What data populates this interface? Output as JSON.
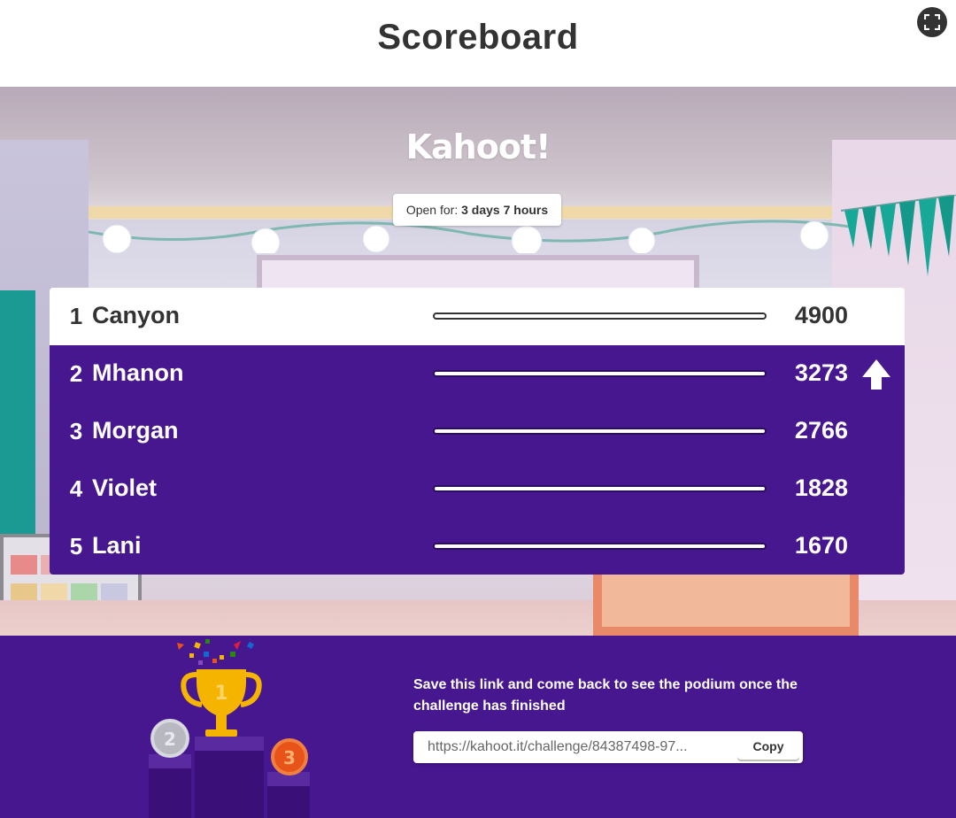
{
  "header": {
    "title": "Scoreboard",
    "fullscreen_icon": "fullscreen-icon"
  },
  "scene": {
    "logo_text": "Kahoot!",
    "open_for_label": "Open for:",
    "open_for_value": "3 days 7 hours"
  },
  "leaderboard": {
    "rows": [
      {
        "rank": "1",
        "name": "Canyon",
        "score": "4900",
        "trend": ""
      },
      {
        "rank": "2",
        "name": "Mhanon",
        "score": "3273",
        "trend": "up-arrow-icon"
      },
      {
        "rank": "3",
        "name": "Morgan",
        "score": "2766",
        "trend": ""
      },
      {
        "rank": "4",
        "name": "Violet",
        "score": "1828",
        "trend": ""
      },
      {
        "rank": "5",
        "name": "Lani",
        "score": "1670",
        "trend": ""
      }
    ]
  },
  "footer": {
    "save_message": "Save this link and come back to see the podium once the challenge has finished",
    "link_value": "https://kahoot.it/challenge/84387498-97...",
    "copy_label": "Copy",
    "podium_labels": [
      "1",
      "2",
      "3"
    ]
  },
  "colors": {
    "brand_purple": "#46178f",
    "text_dark": "#333333",
    "gold": "#f5b400",
    "silver": "#b8b8c0",
    "bronze": "#e8531a"
  }
}
